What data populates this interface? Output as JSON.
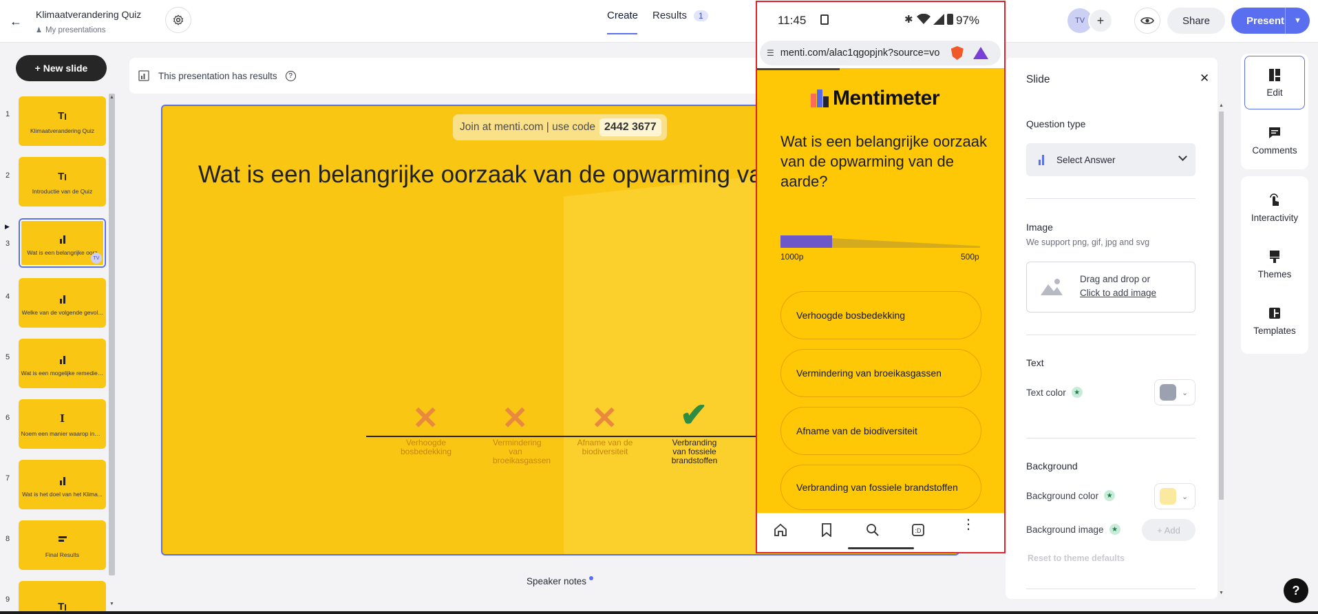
{
  "header": {
    "title": "Klimaatverandering Quiz",
    "breadcrumb": "My presentations",
    "tabs": [
      {
        "label": "Create"
      },
      {
        "label": "Results",
        "badge": "1"
      }
    ],
    "avatar": "TV",
    "share_label": "Share",
    "present_label": "Present"
  },
  "sidebar": {
    "new_slide_label": "+ New slide",
    "slides": [
      {
        "num": "1",
        "icon": "TI",
        "title": "Klimaatverandering Quiz"
      },
      {
        "num": "2",
        "icon": "TI",
        "title": "Introductie van de Quiz"
      },
      {
        "num": "3",
        "icon": "bar-chart",
        "title": "Wat is een belangrijke oorz",
        "avatar": "TV"
      },
      {
        "num": "4",
        "icon": "bar-chart",
        "title": "Welke van de volgende gevol..."
      },
      {
        "num": "5",
        "icon": "bar-chart",
        "title": "Wat is een mogelijke remedie ..."
      },
      {
        "num": "6",
        "icon": "I",
        "title": "Noem een manier waarop indi..."
      },
      {
        "num": "7",
        "icon": "bar-chart",
        "title": "Wat is het doel van het Klima..."
      },
      {
        "num": "8",
        "icon": "leaderboard",
        "title": "Final Results"
      },
      {
        "num": "9",
        "icon": "TI",
        "title": ""
      }
    ]
  },
  "results_banner": "This presentation has results",
  "slide": {
    "join_text": "Join at menti.com | use code",
    "join_code": "2442 3677",
    "question": "Wat is een belangrijke oorzaak van de opwarming van de aarde?",
    "chart_options": [
      {
        "label": "Verhoogde bosbedekking",
        "correct": false
      },
      {
        "label": "Vermindering van broeikasgassen",
        "correct": false
      },
      {
        "label": "Afname van de biodiversiteit",
        "correct": false
      },
      {
        "label": "Verbranding van fossiele brandstoffen",
        "correct": true
      }
    ]
  },
  "speaker_notes_label": "Speaker notes",
  "phone": {
    "time": "11:45",
    "battery": "97%",
    "url": "menti.com/alac1qgopjnk?source=vo",
    "brand": "Mentimeter",
    "question": "Wat is een belangrijke oorzaak van de opwarming van de aarde?",
    "points_max": "1000p",
    "points_min": "500p",
    "timer_fraction": 0.26,
    "options": [
      "Verhoogde bosbedekking",
      "Vermindering van broeikasgassen",
      "Afname van de biodiversiteit",
      "Verbranding van fossiele brandstoffen"
    ]
  },
  "right_panel": {
    "title": "Slide",
    "question_type_label": "Question type",
    "question_type_value": "Select Answer",
    "image_label": "Image",
    "image_hint": "We support png, gif, jpg and svg",
    "drop_text": "Drag and drop or",
    "drop_link": "Click to add image",
    "text_label": "Text",
    "text_color_label": "Text color",
    "text_color": "#9ca1b0",
    "background_label": "Background",
    "bg_color_label": "Background color",
    "bg_color": "#fbe9a0",
    "bg_image_label": "Background image",
    "add_label": "+ Add",
    "reset_label": "Reset to theme defaults"
  },
  "tools": [
    {
      "label": "Edit",
      "icon": "edit-icon"
    },
    {
      "label": "Comments",
      "icon": "comments-icon"
    },
    {
      "label": "Interactivity",
      "icon": "interactivity-icon"
    },
    {
      "label": "Themes",
      "icon": "themes-icon"
    },
    {
      "label": "Templates",
      "icon": "templates-icon"
    }
  ],
  "help_label": "?",
  "colors": {
    "slide_bg": "#f9c613",
    "accent": "#5a6ff0",
    "correct": "#2e8c43",
    "wrong": "#e8893d"
  }
}
